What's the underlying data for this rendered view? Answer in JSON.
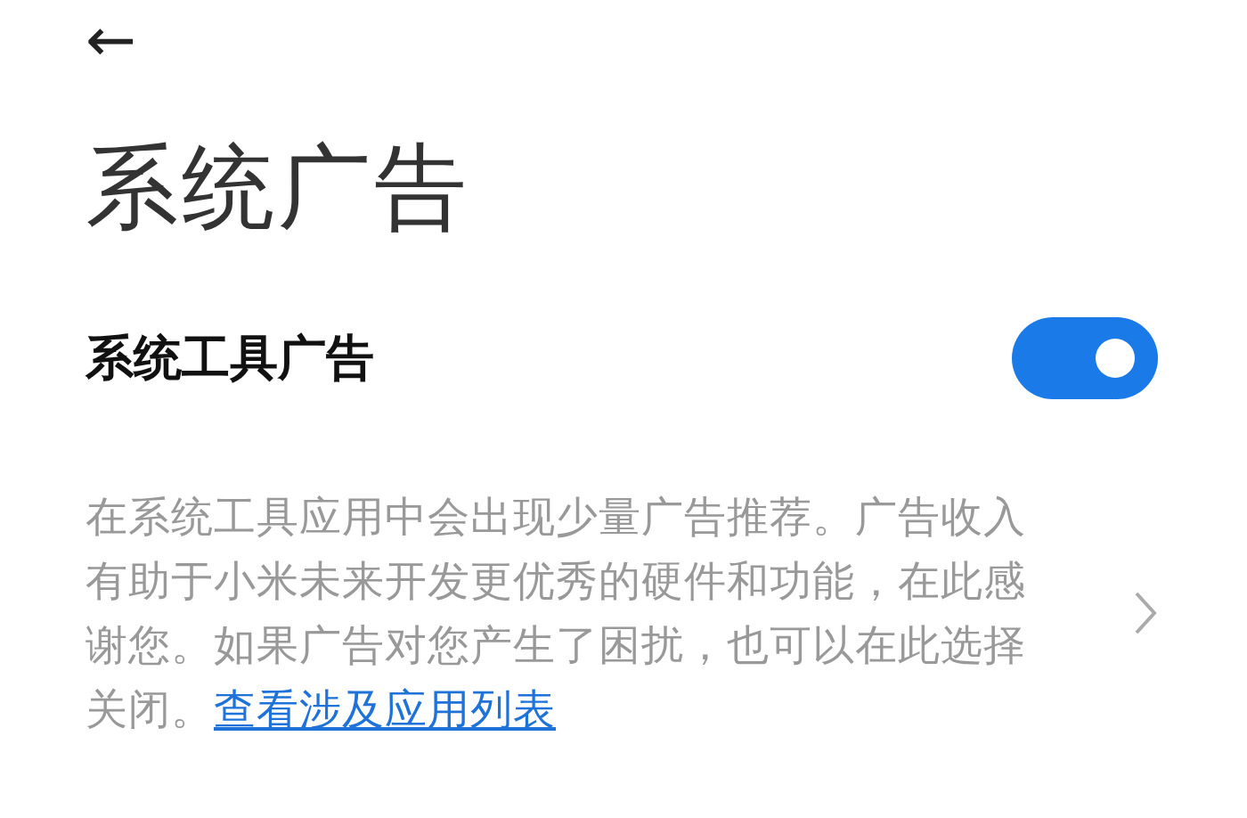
{
  "header": {
    "back": "←"
  },
  "page_title": "系统广告",
  "setting": {
    "label": "系统工具广告",
    "on": true
  },
  "description": {
    "text": "在系统工具应用中会出现少量广告推荐。广告收入有助于小米未来开发更优秀的硬件和功能，在此感谢您。如果广告对您产生了困扰，也可以在此选择关闭。",
    "link": "查看涉及应用列表"
  }
}
